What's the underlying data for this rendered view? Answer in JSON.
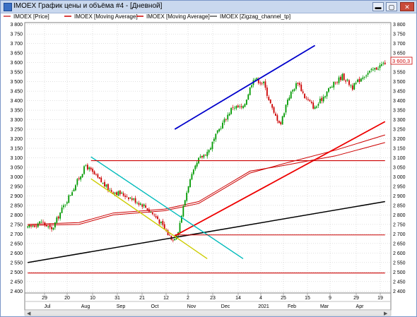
{
  "window": {
    "title": "IMOEX График цены и объёма #4 - [Дневной]",
    "min_glyph": "▬",
    "max_glyph": "▢",
    "close_glyph": "✕"
  },
  "legend": [
    {
      "label": "IMOEX [Price]",
      "color": "#cc3333"
    },
    {
      "label": "IMOEX [Moving Average]",
      "color": "#cc0000"
    },
    {
      "label": "IMOEX [Moving Average]",
      "color": "#cc0000"
    },
    {
      "label": "IMOEX [Zigzag_channel_tp]",
      "color": "#555555"
    }
  ],
  "chart_data": {
    "type": "candlestick",
    "ylim": [
      2390,
      3810
    ],
    "y_ticks": [
      "3 800",
      "3 750",
      "3 700",
      "3 650",
      "3 600",
      "3 550",
      "3 500",
      "3 450",
      "3 400",
      "3 350",
      "3 300",
      "3 250",
      "3 200",
      "3 150",
      "3 100",
      "3 050",
      "3 000",
      "2 950",
      "2 900",
      "2 850",
      "2 800",
      "2 750",
      "2 700",
      "2 650",
      "2 600",
      "2 550",
      "2 500",
      "2 450",
      "2 400"
    ],
    "x_day_labels": [
      "29",
      "20",
      "10",
      "31",
      "21",
      "12",
      "2",
      "23",
      "14",
      "4",
      "25",
      "15",
      "9",
      "29",
      "19"
    ],
    "x_month_labels": [
      "Jul",
      "Aug",
      "Sep",
      "Oct",
      "Nov",
      "Dec",
      "2021",
      "Feb",
      "Mar",
      "Apr"
    ],
    "last_price_label": "3 600,3",
    "colors": {
      "up": "#009900",
      "down": "#cc0000",
      "grid": "#c0c0c0"
    },
    "price_path": [
      [
        0,
        2730
      ],
      [
        8,
        2765
      ],
      [
        14,
        2720
      ],
      [
        20,
        2830
      ],
      [
        28,
        2960
      ],
      [
        34,
        3060
      ],
      [
        40,
        3000
      ],
      [
        48,
        2930
      ],
      [
        58,
        2900
      ],
      [
        68,
        2850
      ],
      [
        76,
        2780
      ],
      [
        82,
        2700
      ],
      [
        85,
        2670
      ],
      [
        88,
        2720
      ],
      [
        94,
        2960
      ],
      [
        100,
        3090
      ],
      [
        106,
        3140
      ],
      [
        112,
        3250
      ],
      [
        120,
        3370
      ],
      [
        126,
        3360
      ],
      [
        132,
        3520
      ],
      [
        138,
        3490
      ],
      [
        144,
        3330
      ],
      [
        148,
        3280
      ],
      [
        152,
        3410
      ],
      [
        158,
        3500
      ],
      [
        162,
        3420
      ],
      [
        168,
        3360
      ],
      [
        176,
        3460
      ],
      [
        184,
        3530
      ],
      [
        190,
        3470
      ],
      [
        196,
        3530
      ],
      [
        202,
        3560
      ],
      [
        209,
        3600
      ]
    ],
    "moving_averages": [
      {
        "name": "IMOEX [Moving Average]",
        "points": [
          [
            0,
            2750
          ],
          [
            30,
            2760
          ],
          [
            50,
            2810
          ],
          [
            80,
            2830
          ],
          [
            100,
            2870
          ],
          [
            115,
            2950
          ],
          [
            130,
            3030
          ],
          [
            150,
            3060
          ],
          [
            180,
            3110
          ],
          [
            209,
            3180
          ]
        ]
      },
      {
        "name": "IMOEX [Moving Average]",
        "points": [
          [
            0,
            2745
          ],
          [
            30,
            2750
          ],
          [
            50,
            2800
          ],
          [
            80,
            2822
          ],
          [
            100,
            2860
          ],
          [
            115,
            2940
          ],
          [
            130,
            3020
          ],
          [
            150,
            3070
          ],
          [
            180,
            3140
          ],
          [
            209,
            3220
          ]
        ]
      }
    ],
    "lines": [
      {
        "color": "#0000cc",
        "width": 1.8,
        "points": [
          [
            86,
            3250
          ],
          [
            168,
            3690
          ]
        ]
      },
      {
        "color": "#ee0000",
        "width": 1.8,
        "points": [
          [
            86,
            2690
          ],
          [
            209,
            3290
          ]
        ]
      },
      {
        "color": "#000000",
        "width": 1.5,
        "points": [
          [
            0,
            2550
          ],
          [
            209,
            2870
          ]
        ]
      },
      {
        "color": "#00bbbb",
        "width": 1.4,
        "points": [
          [
            37,
            3105
          ],
          [
            126,
            2570
          ]
        ]
      },
      {
        "color": "#cccc00",
        "width": 1.4,
        "points": [
          [
            37,
            2990
          ],
          [
            105,
            2570
          ]
        ]
      },
      {
        "color": "#cc0000",
        "width": 1.2,
        "points": [
          [
            37,
            3085
          ],
          [
            209,
            3085
          ]
        ]
      },
      {
        "color": "#cc0000",
        "width": 1.0,
        "points": [
          [
            86,
            2695
          ],
          [
            209,
            2695
          ]
        ]
      },
      {
        "color": "#cc0000",
        "width": 1.2,
        "points": [
          [
            0,
            2495
          ],
          [
            209,
            2495
          ]
        ]
      }
    ]
  }
}
